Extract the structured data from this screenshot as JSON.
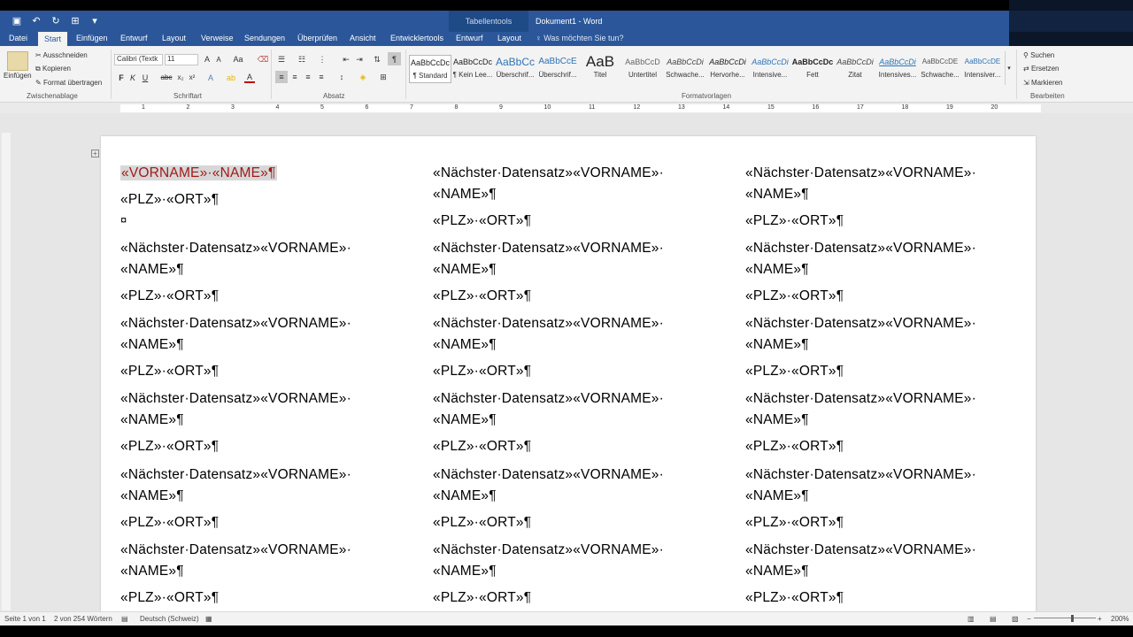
{
  "titlebar": {
    "contextual_group": "Tabellentools",
    "document_title": "Dokument1 - Word"
  },
  "tabs": [
    "Datei",
    "Start",
    "Einfügen",
    "Entwurf",
    "Layout",
    "Verweise",
    "Sendungen",
    "Überprüfen",
    "Ansicht",
    "Entwicklertools",
    "Entwurf",
    "Layout"
  ],
  "tell_me": "Was möchten Sie tun?",
  "ribbon": {
    "clipboard": {
      "paste": "Einfügen",
      "cut": "Ausschneiden",
      "copy": "Kopieren",
      "format_painter": "Format übertragen",
      "group_label": "Zwischenablage"
    },
    "font": {
      "font_name": "Calibri (Textk",
      "font_size": "11",
      "bold": "F",
      "italic": "K",
      "underline": "U",
      "group_label": "Schriftart"
    },
    "paragraph": {
      "group_label": "Absatz"
    },
    "styles": {
      "items": [
        {
          "preview": "AaBbCcDc",
          "name": "¶ Standard"
        },
        {
          "preview": "AaBbCcDc",
          "name": "¶ Kein Lee..."
        },
        {
          "preview": "AaBbCc",
          "name": "Überschrif..."
        },
        {
          "preview": "AaBbCcE",
          "name": "Überschrif..."
        },
        {
          "preview": "AaB",
          "name": "Titel"
        },
        {
          "preview": "AaBbCcD",
          "name": "Untertitel"
        },
        {
          "preview": "AaBbCcDi",
          "name": "Schwache..."
        },
        {
          "preview": "AaBbCcDi",
          "name": "Hervorhe..."
        },
        {
          "preview": "AaBbCcDi",
          "name": "Intensive..."
        },
        {
          "preview": "AaBbCcDc",
          "name": "Fett"
        },
        {
          "preview": "AaBbCcDi",
          "name": "Zitat"
        },
        {
          "preview": "AaBbCcDi",
          "name": "Intensives..."
        },
        {
          "preview": "AaBbCcDE",
          "name": "Schwache..."
        },
        {
          "preview": "AaBbCcDE",
          "name": "Intensiver..."
        }
      ],
      "group_label": "Formatvorlagen"
    },
    "editing": {
      "find": "Suchen",
      "replace": "Ersetzen",
      "select": "Markieren",
      "group_label": "Bearbeiten"
    }
  },
  "ruler_numbers": [
    "1",
    "2",
    "3",
    "4",
    "5",
    "6",
    "7",
    "8",
    "9",
    "10",
    "11",
    "12",
    "13",
    "14",
    "15",
    "16",
    "17",
    "18",
    "19",
    "20"
  ],
  "document": {
    "first_cell": {
      "selected": "«VORNAME»·«NAME»¶",
      "plz": "«PLZ»·«ORT»¶",
      "end_mark": "¤"
    },
    "next_line1": "«Nächster·Datensatz»«VORNAME»·",
    "next_line2": "«NAME»¶",
    "plz_line": "«PLZ»·«ORT»¶"
  },
  "status": {
    "page": "Seite 1 von 1",
    "words": "2 von 254 Wörtern",
    "language": "Deutsch (Schweiz)",
    "zoom": "200%"
  }
}
